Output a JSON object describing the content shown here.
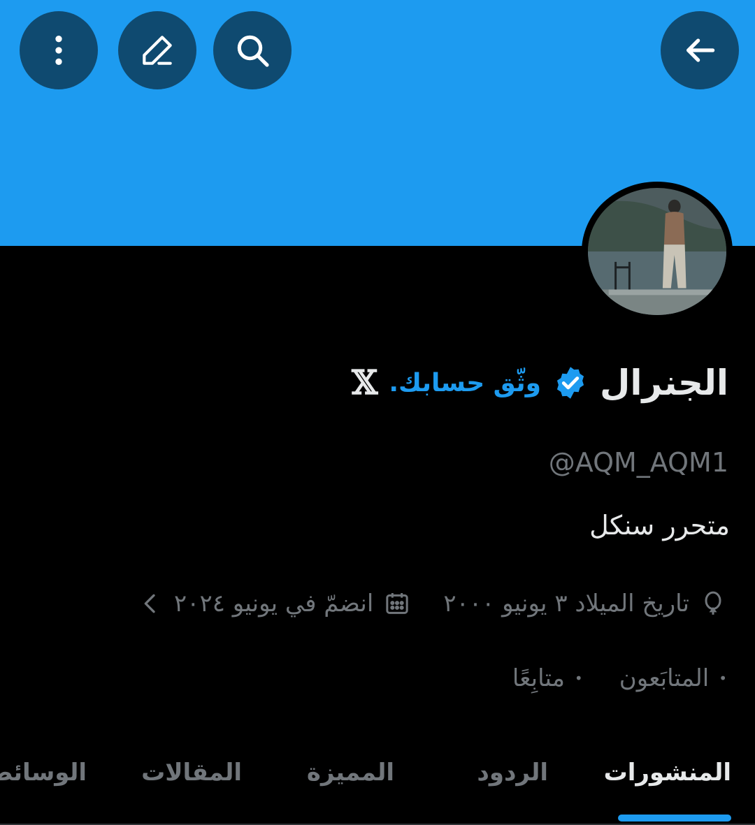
{
  "header": {
    "back_icon": "arrow-left-icon",
    "search_icon": "search-icon",
    "edit_icon": "pencil-icon",
    "more_icon": "more-vertical-icon",
    "banner_color": "#1d9bf0"
  },
  "profile": {
    "display_name": "الجنرال",
    "verify_link": "وثّق حسابك.",
    "x_logo": "𝕏",
    "handle": "@AQM_AQM1",
    "bio": "متحرر سنكل",
    "birthday": "تاريخ الميلاد ٣ يونيو ٢٠٠٠",
    "joined": "انضمّ في يونيو ٢٠٢٤",
    "followers_label": "المتابَعون",
    "following_label": "متابِعًا",
    "bullet": "•"
  },
  "tabs": [
    {
      "label": "المنشورات",
      "active": true
    },
    {
      "label": "الردود",
      "active": false
    },
    {
      "label": "المميزة",
      "active": false
    },
    {
      "label": "المقالات",
      "active": false
    },
    {
      "label": "الوسائط",
      "active": false
    }
  ],
  "colors": {
    "accent": "#1d9bf0",
    "text_primary": "#e7e9ea",
    "text_secondary": "#71767b",
    "background": "#000000"
  }
}
